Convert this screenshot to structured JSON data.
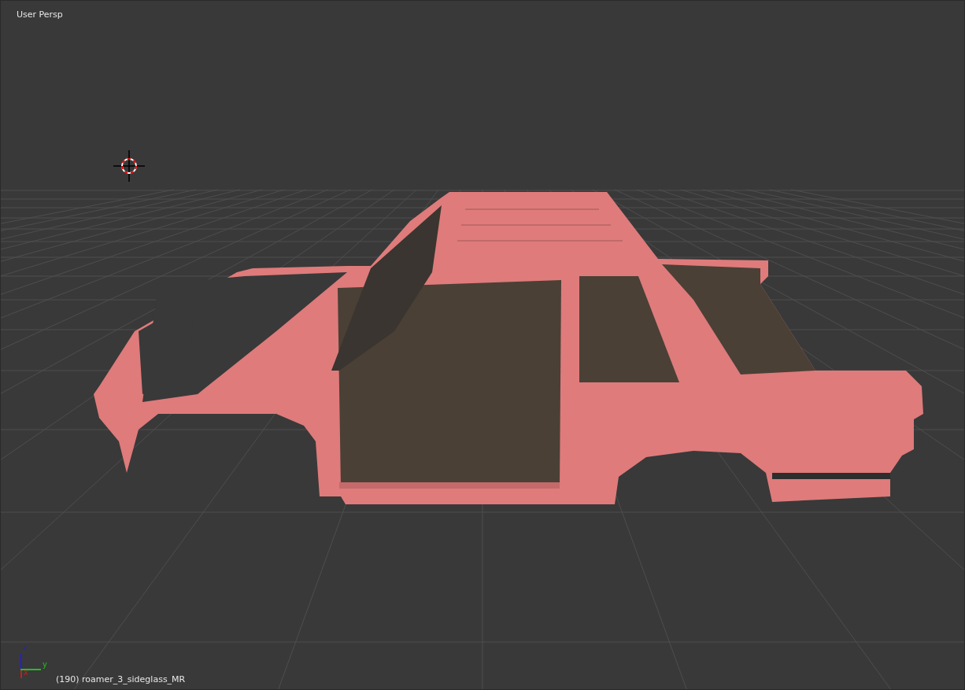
{
  "viewport": {
    "view_label": "User Persp",
    "object_label": "(190) roamer_3_sideglass_MR"
  },
  "axis_gizmo": {
    "axes": [
      {
        "label": "z",
        "color": "#2020e0"
      },
      {
        "label": "y",
        "color": "#20c020"
      },
      {
        "label": "x",
        "color": "#c02020"
      }
    ]
  }
}
